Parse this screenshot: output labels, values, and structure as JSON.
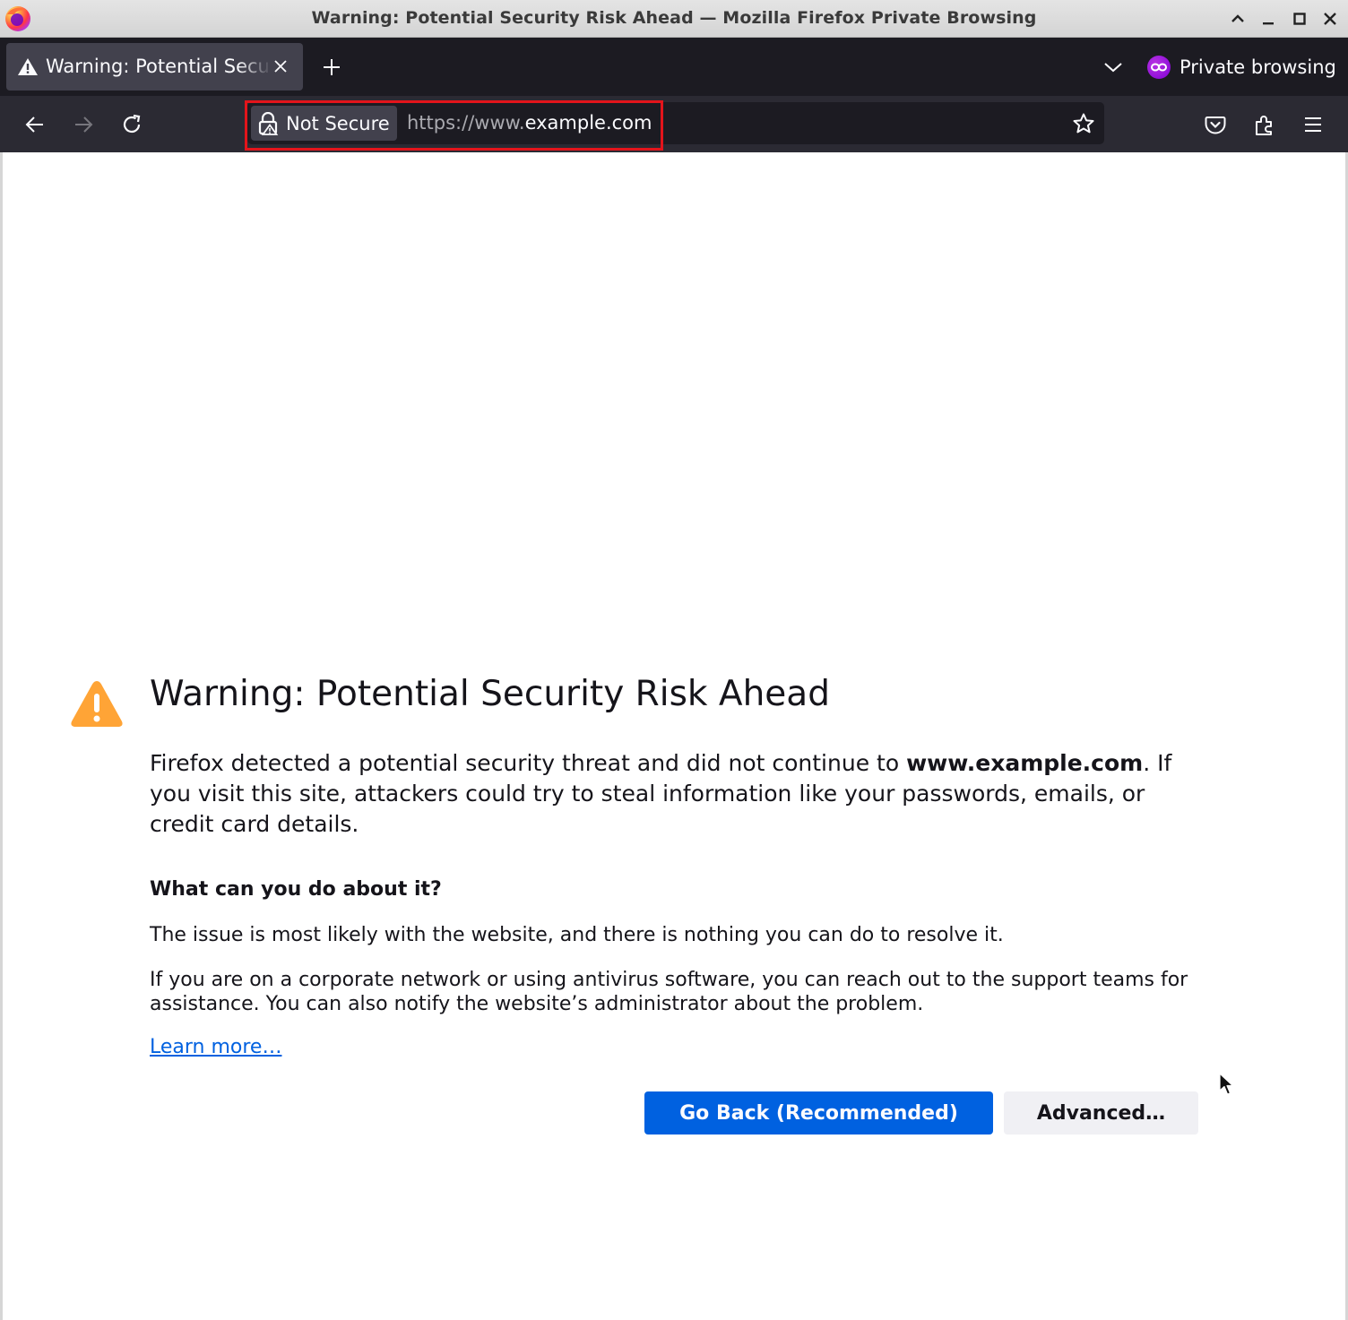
{
  "window": {
    "title": "Warning: Potential Security Risk Ahead — Mozilla Firefox Private Browsing"
  },
  "tabs": [
    {
      "label": "Warning: Potential Security Risk Ahead",
      "icon": "warning-icon",
      "active": true
    }
  ],
  "tabstrip": {
    "private_label": "Private browsing",
    "private_icon": "private-browsing-mask-icon"
  },
  "navbar": {
    "identity_label": "Not Secure",
    "identity_icon": "insecure-lock-icon",
    "url_prefix": "https://www.",
    "url_host": "example.com",
    "highlight_color": "#e3141b"
  },
  "error_page": {
    "title": "Warning: Potential Security Risk Ahead",
    "intro_before": "Firefox detected a potential security threat and did not continue to ",
    "intro_host": "www.example.com",
    "intro_after": ". If you visit this site, attackers could try to steal information like your passwords, emails, or credit card details.",
    "subtitle": "What can you do about it?",
    "p1": "The issue is most likely with the website, and there is nothing you can do to resolve it.",
    "p2": "If you are on a corporate network or using antivirus software, you can reach out to the support teams for assistance. You can also notify the website’s administrator about the problem.",
    "learn_more": "Learn more…",
    "go_back_button": "Go Back (Recommended)",
    "advanced_button": "Advanced…"
  },
  "colors": {
    "accent": "#0061e0",
    "warning": "#ffa436",
    "toolbar_dark": "#2b2a33",
    "tabstrip_dark": "#1c1b22"
  }
}
